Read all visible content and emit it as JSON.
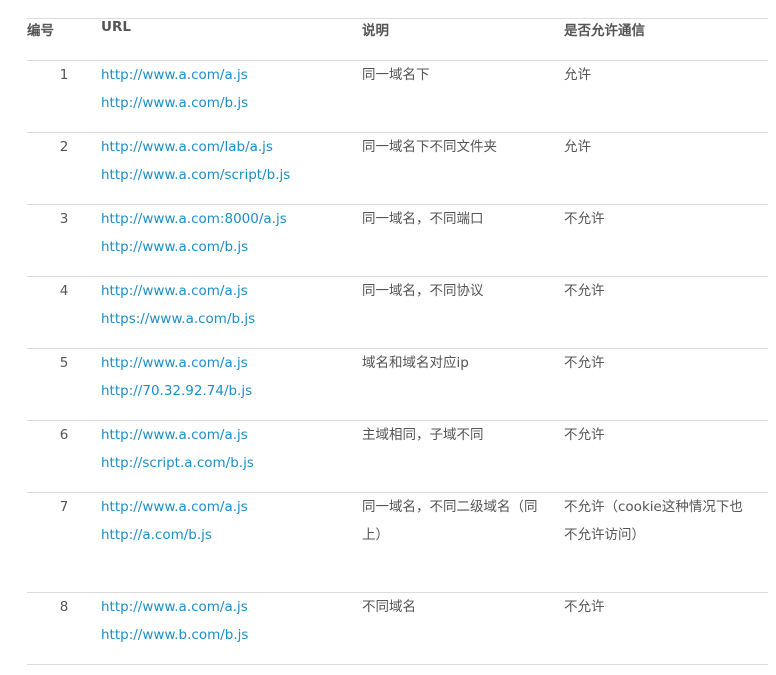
{
  "table": {
    "headers": {
      "num": "编号",
      "url": "URL",
      "desc": "说明",
      "allow": "是否允许通信"
    },
    "rows": [
      {
        "num": "1",
        "url1": "http://www.a.com/a.js",
        "url2": "http://www.a.com/b.js",
        "desc": "同一域名下",
        "allow": "允许"
      },
      {
        "num": "2",
        "url1": "http://www.a.com/lab/a.js",
        "url2": "http://www.a.com/script/b.js",
        "desc": "同一域名下不同文件夹",
        "allow": "允许"
      },
      {
        "num": "3",
        "url1": "http://www.a.com:8000/a.js",
        "url2": "http://www.a.com/b.js",
        "desc": "同一域名，不同端口",
        "allow": "不允许"
      },
      {
        "num": "4",
        "url1": "http://www.a.com/a.js",
        "url2": "https://www.a.com/b.js",
        "desc": "同一域名，不同协议",
        "allow": "不允许"
      },
      {
        "num": "5",
        "url1": "http://www.a.com/a.js",
        "url2": "http://70.32.92.74/b.js",
        "desc": "域名和域名对应ip",
        "allow": "不允许"
      },
      {
        "num": "6",
        "url1": "http://www.a.com/a.js",
        "url2": "http://script.a.com/b.js",
        "desc": "主域相同，子域不同",
        "allow": "不允许"
      },
      {
        "num": "7",
        "url1": "http://www.a.com/a.js",
        "url2": "http://a.com/b.js",
        "desc": "同一域名，不同二级域名（同上）",
        "allow": "不允许（cookie这种情况下也不允许访问）"
      },
      {
        "num": "8",
        "url1": "http://www.a.com/a.js",
        "url2": "http://www.b.com/b.js",
        "desc": "不同域名",
        "allow": "不允许"
      }
    ]
  }
}
